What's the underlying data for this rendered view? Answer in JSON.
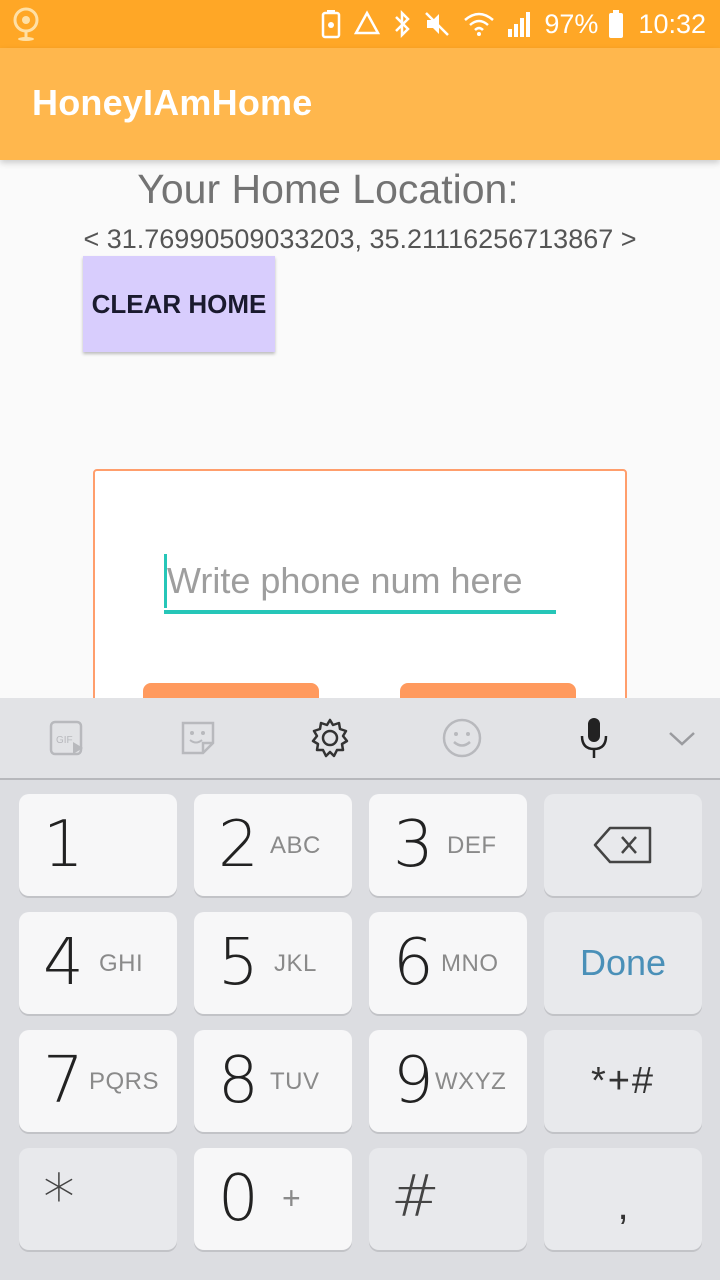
{
  "status_bar": {
    "battery": "97%",
    "time": "10:32"
  },
  "app_bar": {
    "title": "HoneyIAmHome"
  },
  "main": {
    "home_heading": "Your Home Location:",
    "home_coords": "< 31.76990509033203, 35.21116256713867 >",
    "clear_button": "CLEAR HOME",
    "phone_placeholder": "Write phone num here",
    "phone_value": ""
  },
  "keyboard": {
    "toolbar_icons": [
      "gif-icon",
      "sticker-icon",
      "settings-icon",
      "emoji-icon",
      "microphone-icon",
      "chevron-down-icon"
    ],
    "keys": {
      "k1": {
        "digit": "1",
        "letters": ""
      },
      "k2": {
        "digit": "2",
        "letters": "ABC"
      },
      "k3": {
        "digit": "3",
        "letters": "DEF"
      },
      "k4": {
        "digit": "4",
        "letters": "GHI"
      },
      "k5": {
        "digit": "5",
        "letters": "JKL"
      },
      "k6": {
        "digit": "6",
        "letters": "MNO"
      },
      "k7": {
        "digit": "7",
        "letters": "PQRS"
      },
      "k8": {
        "digit": "8",
        "letters": "TUV"
      },
      "k9": {
        "digit": "9",
        "letters": "WXYZ"
      },
      "k0": {
        "digit": "0",
        "letters": "+"
      },
      "star": "*",
      "hash": "#",
      "comma": ",",
      "done": "Done",
      "symbols": "*+#"
    }
  },
  "colors": {
    "status_bar": "#ffa726",
    "app_bar": "#ffb74d",
    "clear_button": "#d8cdfd",
    "card_border": "#ff9e6c",
    "accent": "#26c6b8",
    "done_text": "#4a90b8"
  }
}
